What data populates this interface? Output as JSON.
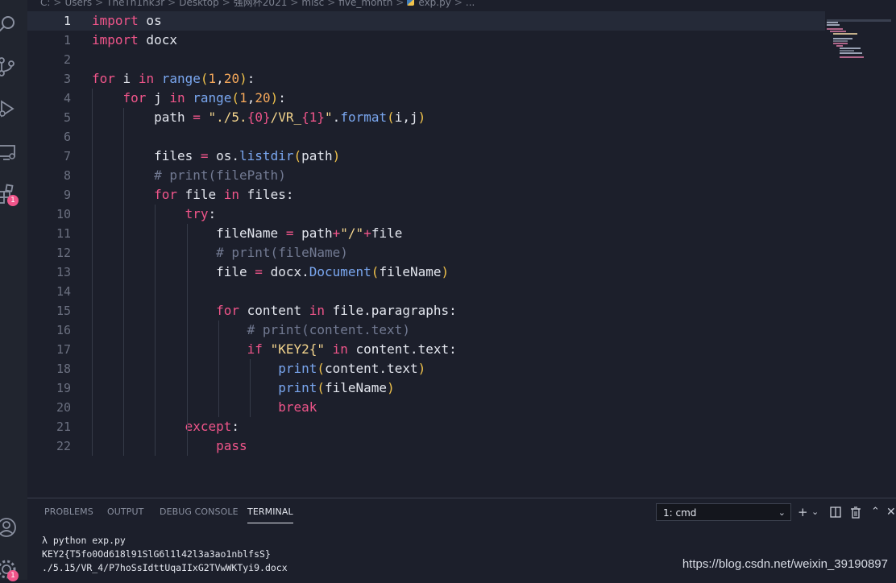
{
  "breadcrumb": [
    "C:",
    "Users",
    "TheTh1nk3r",
    "Desktop",
    "强网杯2021",
    "misc",
    "five_month",
    "exp.py",
    "..."
  ],
  "activity": {
    "extensions_badge": "1",
    "accounts_badge": "1"
  },
  "editor": {
    "current_line_number": "1",
    "lines": [
      {
        "n": "1",
        "html": "<span class=\"kw\">import</span> os"
      },
      {
        "n": "1",
        "html": "<span class=\"kw\">import</span> docx"
      },
      {
        "n": "2",
        "html": ""
      },
      {
        "n": "3",
        "html": "<span class=\"kw\">for</span> i <span class=\"kw\">in</span> <span class=\"fn\">range</span><span class=\"pu\">(</span><span class=\"num\">1</span>,<span class=\"num\">20</span><span class=\"pu\">)</span>:"
      },
      {
        "n": "4",
        "html": "    <span class=\"kw\">for</span> j <span class=\"kw\">in</span> <span class=\"fn\">range</span><span class=\"pu\">(</span><span class=\"num\">1</span>,<span class=\"num\">20</span><span class=\"pu\">)</span>:"
      },
      {
        "n": "5",
        "html": "        path <span class=\"op\">=</span> <span class=\"str\">\"./5.</span><span class=\"kw\">{0}</span><span class=\"str\">/VR_</span><span class=\"kw\">{1}</span><span class=\"str\">\"</span>.<span class=\"fn\">format</span><span class=\"pu\">(</span>i,j<span class=\"pu\">)</span>"
      },
      {
        "n": "6",
        "html": ""
      },
      {
        "n": "7",
        "html": "        files <span class=\"op\">=</span> os.<span class=\"fn\">listdir</span><span class=\"pu\">(</span>path<span class=\"pu\">)</span>"
      },
      {
        "n": "8",
        "html": "        <span class=\"cm\"># print(filePath)</span>"
      },
      {
        "n": "9",
        "html": "        <span class=\"kw\">for</span> file <span class=\"kw\">in</span> files:"
      },
      {
        "n": "10",
        "html": "            <span class=\"kw\">try</span>:"
      },
      {
        "n": "11",
        "html": "                fileName <span class=\"op\">=</span> path<span class=\"op\">+</span><span class=\"str\">\"/\"</span><span class=\"op\">+</span>file"
      },
      {
        "n": "12",
        "html": "                <span class=\"cm\"># print(fileName)</span>"
      },
      {
        "n": "13",
        "html": "                file <span class=\"op\">=</span> docx.<span class=\"fn\">Document</span><span class=\"pu\">(</span>fileName<span class=\"pu\">)</span>"
      },
      {
        "n": "14",
        "html": ""
      },
      {
        "n": "15",
        "html": "                <span class=\"kw\">for</span> content <span class=\"kw\">in</span> file.paragraphs:"
      },
      {
        "n": "16",
        "html": "                    <span class=\"cm\"># print(content.text)</span>"
      },
      {
        "n": "17",
        "html": "                    <span class=\"kw\">if</span> <span class=\"str\">\"KEY2{\"</span> <span class=\"kw\">in</span> content.text:"
      },
      {
        "n": "18",
        "html": "                        <span class=\"fn\">print</span><span class=\"pu\">(</span>content.text<span class=\"pu\">)</span>"
      },
      {
        "n": "19",
        "html": "                        <span class=\"fn\">print</span><span class=\"pu\">(</span>fileName<span class=\"pu\">)</span>"
      },
      {
        "n": "20",
        "html": "                        <span class=\"kw\">break</span>"
      },
      {
        "n": "21",
        "html": "            <span class=\"kw\">except</span>:"
      },
      {
        "n": "22",
        "html": "                <span class=\"kw\">pass</span>"
      }
    ]
  },
  "panel": {
    "tabs": [
      "PROBLEMS",
      "OUTPUT",
      "DEBUG CONSOLE",
      "TERMINAL"
    ],
    "active_tab": "TERMINAL",
    "terminal_select": "1: cmd",
    "terminal_lines": [
      "λ python exp.py",
      "KEY2{T5fo0Od618l91SlG6l1l42l3a3ao1nblfsS}",
      "./5.15/VR_4/P7hoSsIdttUqaIIxG2TVwWKTyi9.docx"
    ]
  },
  "watermark": "https://blog.csdn.net/weixin_39190897",
  "colors": {
    "keyword": "#f0558a",
    "function": "#7aa7f0",
    "number": "#f5a85b",
    "string": "#f4d58d",
    "comment": "#727a92",
    "background": "#1c1f2b"
  }
}
